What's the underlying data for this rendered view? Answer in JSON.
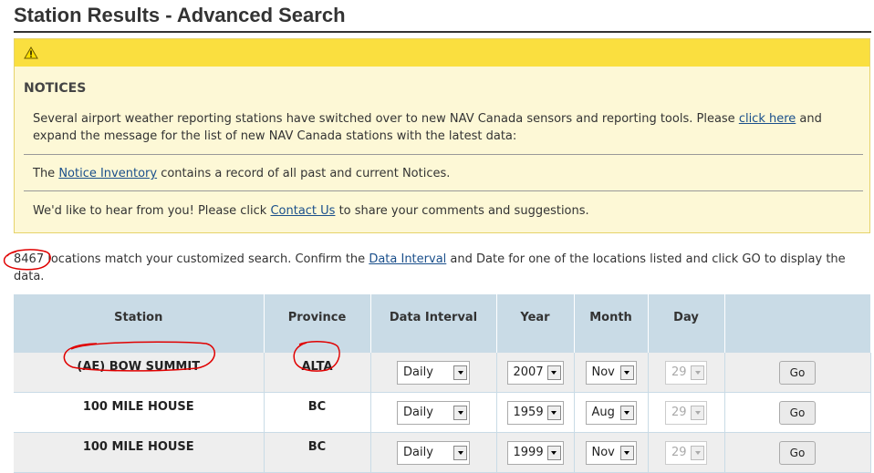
{
  "page": {
    "title": "Station Results - Advanced Search"
  },
  "notices": {
    "heading": "NOTICES",
    "icon": "warning-icon",
    "item1": {
      "text_before": "Several airport weather reporting stations have switched over to new NAV Canada sensors and reporting tools. Please ",
      "link": "click here",
      "text_after": " and expand the message for the list of new NAV Canada stations with the latest data:"
    },
    "item2": {
      "text_before": "The ",
      "link": "Notice Inventory",
      "text_after": " contains a record of all past and current Notices."
    },
    "item3": {
      "text_before": "We'd like to hear from you! Please click ",
      "link": "Contact Us",
      "text_after": " to share your comments and suggestions."
    }
  },
  "intro": {
    "count": "8467",
    "text_before": " locations match your customized search. Confirm the ",
    "link": "Data Interval",
    "text_after": " and Date for one of the locations listed and click GO to display the data."
  },
  "table": {
    "headers": [
      "Station",
      "Province",
      "Data Interval",
      "Year",
      "Month",
      "Day",
      ""
    ],
    "rows": [
      {
        "station": "(AE) BOW SUMMIT",
        "province": "ALTA",
        "interval": "Daily",
        "year": "2007",
        "month": "Nov",
        "day": "29",
        "go": "Go"
      },
      {
        "station": "100 MILE HOUSE",
        "province": "BC",
        "interval": "Daily",
        "year": "1959",
        "month": "Aug",
        "day": "29",
        "go": "Go"
      },
      {
        "station": "100 MILE HOUSE",
        "province": "BC",
        "interval": "Daily",
        "year": "1999",
        "month": "Nov",
        "day": "29",
        "go": "Go"
      }
    ]
  },
  "colors": {
    "notice_bar": "#fadf3f",
    "notice_bg": "#fdf8d6",
    "table_header": "#c9dbe6",
    "link": "#1a4f8b",
    "annotation": "#e00000"
  }
}
